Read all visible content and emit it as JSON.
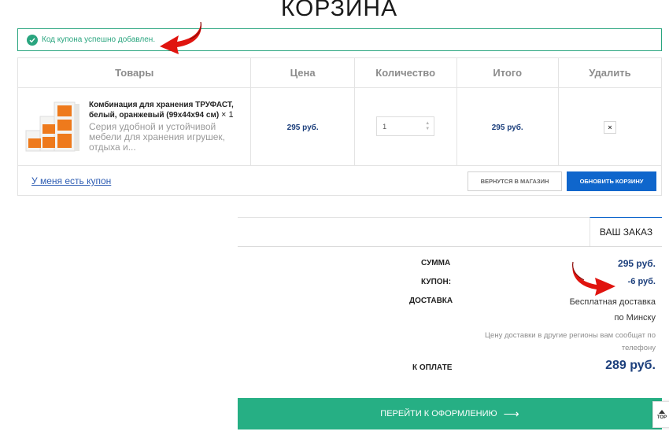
{
  "page": {
    "title": "КОРЗИНА"
  },
  "notice": {
    "text": "Код купона успешно добавлен.",
    "icon": "check-circle-icon",
    "color": "#2aa57f"
  },
  "cart": {
    "headers": {
      "product": "Товары",
      "price": "Цена",
      "quantity": "Количество",
      "total": "Итого",
      "remove": "Удалить"
    },
    "items": [
      {
        "name": "Комбинация для хранения ТРУФАСТ, белый, оранжевый (99x44x94 см)",
        "multiplier": "× 1",
        "description": "Серия удобной и устойчивой мебели для хранения игрушек, отдыха и...",
        "price": "295 руб.",
        "quantity": "1",
        "total": "295 руб.",
        "remove_icon": "×"
      }
    ],
    "coupon_link": "У меня есть купон",
    "back_button": "ВЕРНУТСЯ В МАГАЗИН",
    "update_button": "ОБНОВИТЬ КОРЗИНУ"
  },
  "summary": {
    "tab": "ВАШ ЗАКАЗ",
    "sum_label": "СУММА",
    "sum_value": "295 руб.",
    "coupon_label": "КУПОН:",
    "coupon_value": "-6 руб.",
    "delivery_label": "ДОСТАВКА",
    "delivery_line1": "Бесплатная доставка",
    "delivery_line2": "по Минску",
    "delivery_note1": "Цену доставки в другие регионы вам сообщат по",
    "delivery_note2": "телефону",
    "total_label": "К ОПЛАТЕ",
    "total_value": "289 руб."
  },
  "checkout": {
    "label": "ПЕРЕЙТИ К ОФОРМЛЕНИЮ",
    "arrow": "⟶"
  },
  "to_top": {
    "label": "TOP"
  },
  "colors": {
    "accent_blue": "#0f66cc",
    "accent_green": "#26af84",
    "price_navy": "#1c3f7c",
    "annotation_red": "#e0140f"
  }
}
